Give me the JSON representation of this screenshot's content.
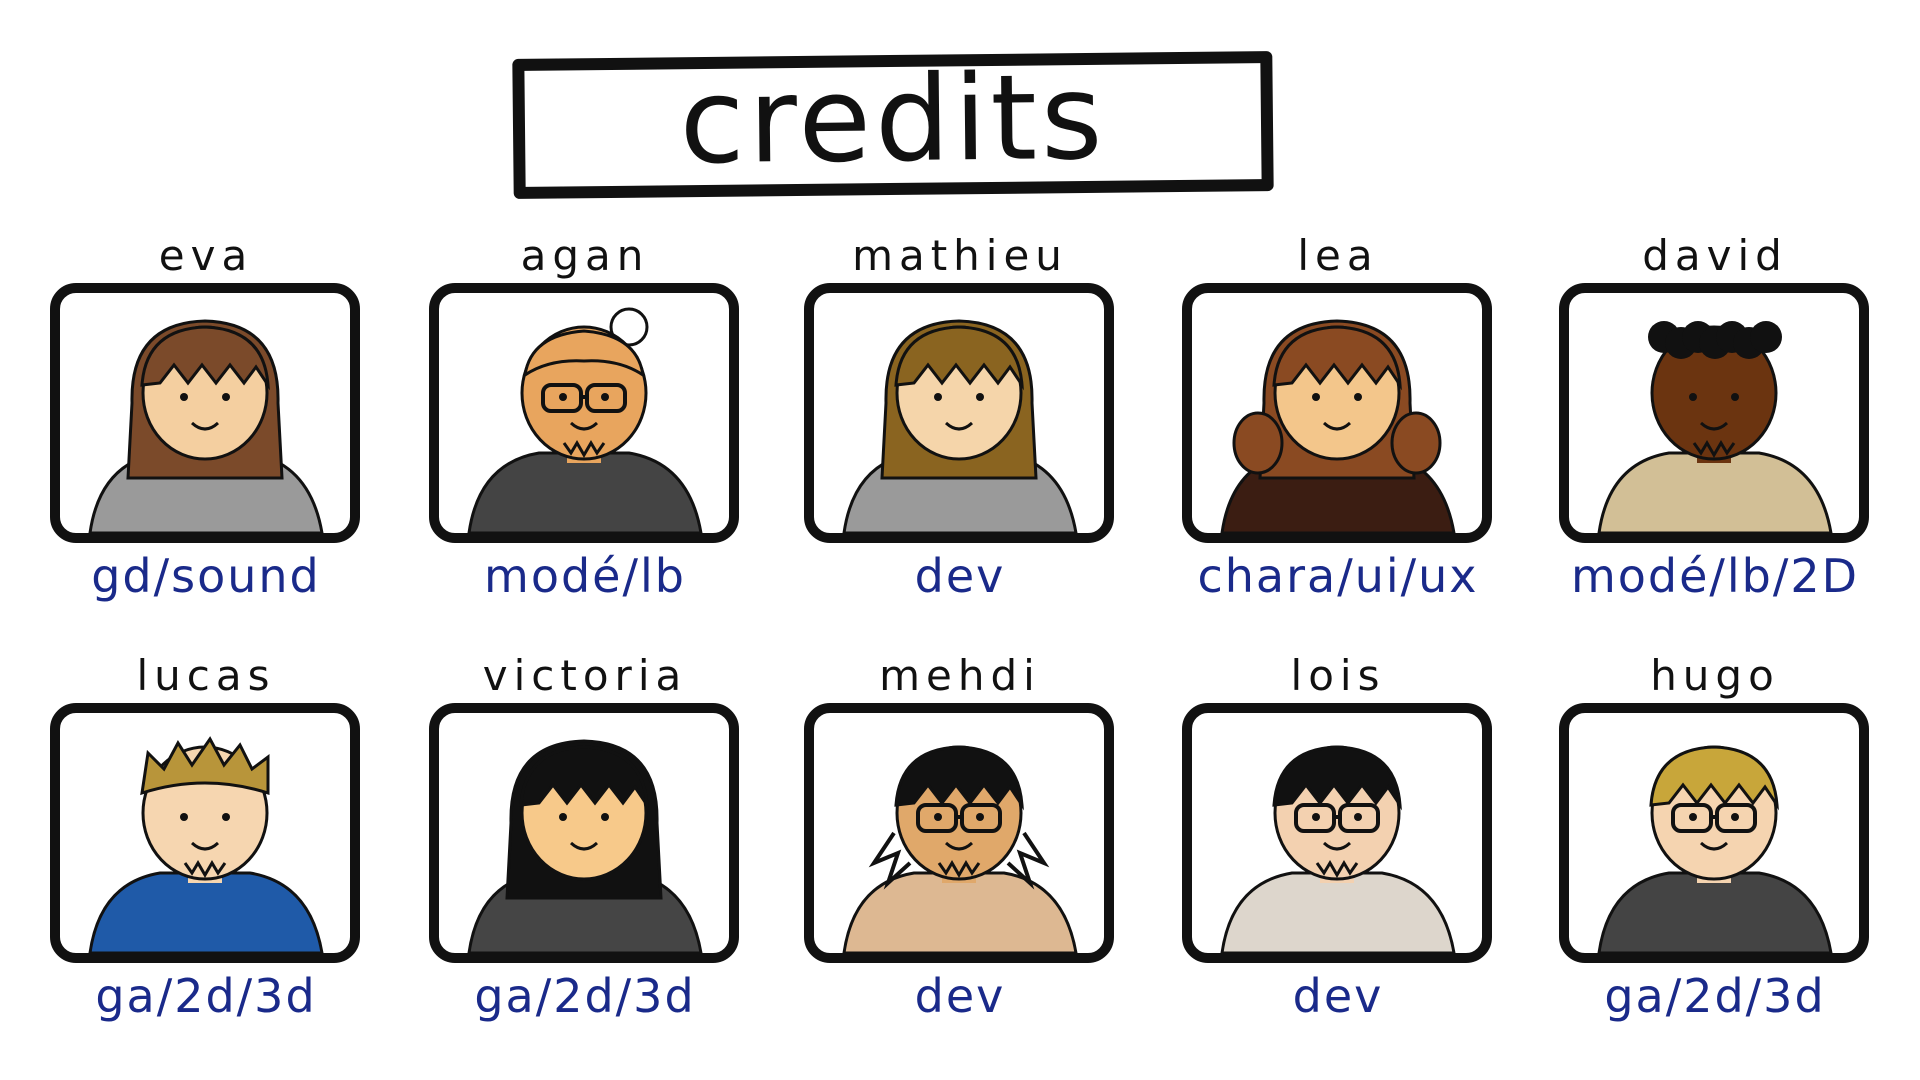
{
  "title": "credits",
  "colors": {
    "ink": "#111111",
    "role_text": "#1a2a8a",
    "skin": "#f6d3a4"
  },
  "members": [
    {
      "name": "eva",
      "role": "gd/sound",
      "skin": "#f4cfa0",
      "hair": "#7b4a2a",
      "hair_style": "long",
      "shirt": "#9a9a9a",
      "glasses": false,
      "beard": false
    },
    {
      "name": "agan",
      "role": "modé/lb",
      "skin": "#e8a55e",
      "hair": "#e8a55e",
      "hair_style": "bun",
      "shirt": "#444444",
      "glasses": true,
      "beard": true
    },
    {
      "name": "mathieu",
      "role": "dev",
      "skin": "#f5d5aa",
      "hair": "#8a6420",
      "hair_style": "long",
      "shirt": "#9a9a9a",
      "glasses": false,
      "beard": false
    },
    {
      "name": "lea",
      "role": "chara/ui/ux",
      "skin": "#f3c68b",
      "hair": "#8a4a22",
      "hair_style": "pigtails",
      "shirt": "#3b1d12",
      "glasses": false,
      "beard": false
    },
    {
      "name": "david",
      "role": "modé/lb/2D",
      "skin": "#6b3410",
      "hair": "#111111",
      "hair_style": "curly",
      "shirt": "#d2bf96",
      "glasses": false,
      "beard": true
    },
    {
      "name": "lucas",
      "role": "ga/2d/3d",
      "skin": "#f6d6b0",
      "hair": "#b8953a",
      "hair_style": "spiky",
      "shirt": "#1f5aa8",
      "glasses": false,
      "beard": true
    },
    {
      "name": "victoria",
      "role": "ga/2d/3d",
      "skin": "#f7c98a",
      "hair": "#111111",
      "hair_style": "long",
      "shirt": "#454545",
      "glasses": false,
      "beard": false
    },
    {
      "name": "mehdi",
      "role": "dev",
      "skin": "#e0a86a",
      "hair": "#111111",
      "hair_style": "messy",
      "shirt": "#ddb892",
      "glasses": true,
      "beard": true
    },
    {
      "name": "lois",
      "role": "dev",
      "skin": "#f3d1b0",
      "hair": "#111111",
      "hair_style": "short",
      "shirt": "#ddd6cc",
      "glasses": true,
      "beard": true
    },
    {
      "name": "hugo",
      "role": "ga/2d/3d",
      "skin": "#f5d4b0",
      "hair": "#c8a63a",
      "hair_style": "short",
      "shirt": "#444444",
      "glasses": true,
      "beard": false
    }
  ]
}
